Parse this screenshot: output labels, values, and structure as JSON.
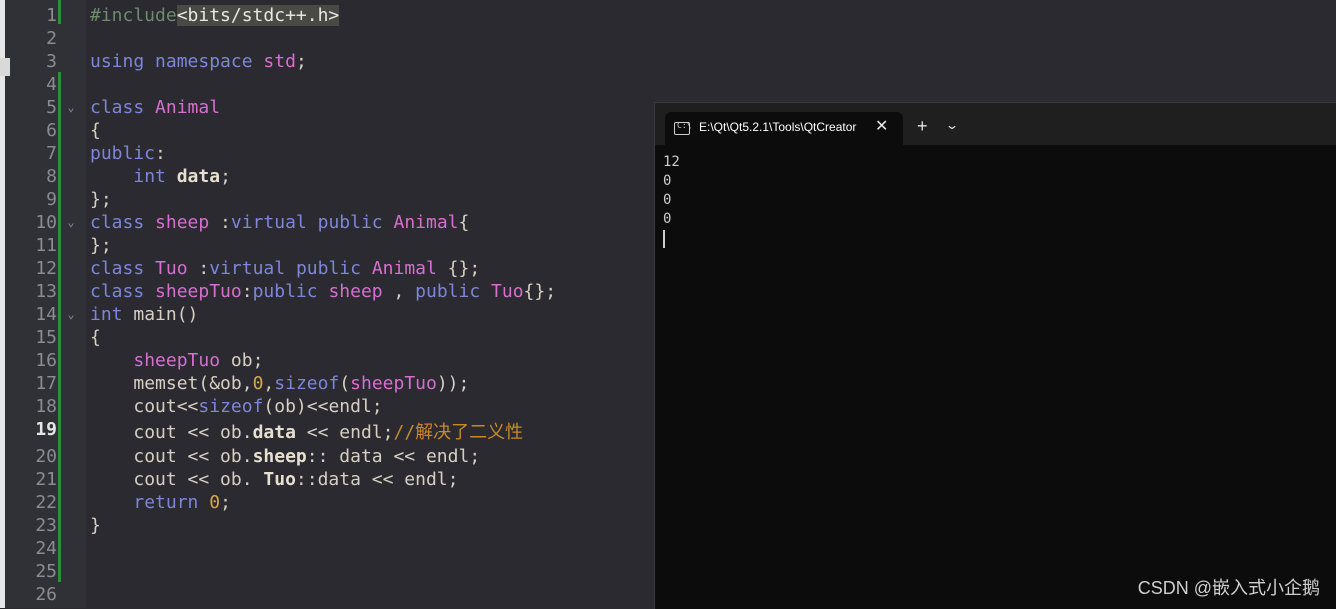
{
  "editor": {
    "line_numbers": [
      "1",
      "2",
      "3",
      "4",
      "5",
      "6",
      "7",
      "8",
      "9",
      "10",
      "11",
      "12",
      "13",
      "14",
      "15",
      "16",
      "17",
      "18",
      "19",
      "20",
      "21",
      "22",
      "23",
      "24",
      "25",
      "26"
    ],
    "current_line": "19",
    "code": {
      "l1_pp": "#include",
      "l1_inc": "<bits/stdc++.h>",
      "l3_kw1": "using",
      "l3_kw2": "namespace",
      "l3_std": "std",
      "l3_end": ";",
      "l5_kw": "class",
      "l5_ty": "Animal",
      "l6": "{",
      "l7_kw": "public",
      "l7_end": ":",
      "l8_kw": "int",
      "l8_var": "data",
      "l8_end": ";",
      "l9": "};",
      "l10_kw": "class",
      "l10_ty": "sheep",
      "l10_colon": " :",
      "l10_kw2": "virtual",
      "l10_kw3": "public",
      "l10_ty2": "Animal",
      "l10_end": "{",
      "l11": "};",
      "l12_kw": "class",
      "l12_ty": "Tuo",
      "l12_colon": " :",
      "l12_kw2": "virtual",
      "l12_kw3": "public",
      "l12_ty2": "Animal",
      "l12_end": " {};",
      "l13_kw": "class",
      "l13_ty": "sheepTuo",
      "l13_colon": ":",
      "l13_kw2": "public",
      "l13_ty2": "sheep",
      "l13_comma": " , ",
      "l13_kw3": "public",
      "l13_ty3": "Tuo",
      "l13_end": "{};",
      "l14_kw": "int",
      "l14_fn": "main()",
      "l15": "{",
      "l16_ty": "sheepTuo",
      "l16_rest": " ob;",
      "l17_a": "memset(&ob,",
      "l17_num": "0",
      "l17_b": ",",
      "l17_kw": "sizeof",
      "l17_c": "(",
      "l17_ty": "sheepTuo",
      "l17_d": "));",
      "l18_a": "cout<<",
      "l18_kw": "sizeof",
      "l18_b": "(ob)<<endl;",
      "l19_a": "cout << ob.",
      "l19_bold": "data",
      "l19_b": " << endl;",
      "l19_cm": "//解决了二义性",
      "l20_a": "cout << ob.",
      "l20_bold": "sheep",
      "l20_b": ":: data << endl;",
      "l21_a": "cout << ob. ",
      "l21_bold": "Tuo",
      "l21_b": "::data << endl;",
      "l22_kw": "return",
      "l22_num": "0",
      "l22_end": ";",
      "l23": "}"
    }
  },
  "terminal": {
    "tab_title": "E:\\Qt\\Qt5.2.1\\Tools\\QtCreator",
    "close_glyph": "✕",
    "new_tab_glyph": "+",
    "dropdown_glyph": "⌄",
    "icon_glyph": "C:\\",
    "output": [
      "12",
      "0",
      "0",
      "0"
    ]
  },
  "watermark": "CSDN @嵌入式小企鹅",
  "colors": {
    "editor_bg": "#2a2a30",
    "keyword": "#7d86d9",
    "type": "#d66fcf",
    "number": "#d6a84c",
    "comment": "#c78a2a",
    "terminal_bg": "#0c0c0c"
  }
}
